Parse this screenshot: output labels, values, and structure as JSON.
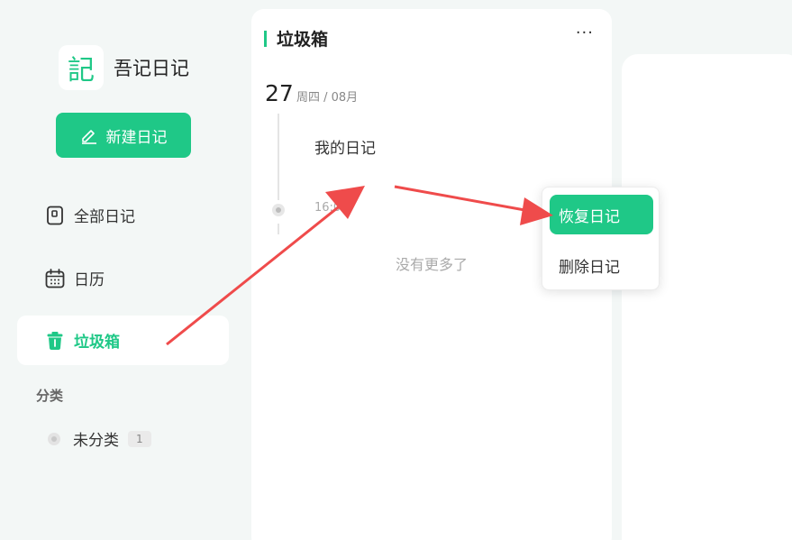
{
  "app": {
    "logo_char": "記",
    "name": "吾记日记"
  },
  "sidebar": {
    "new_button": "新建日记",
    "items": [
      {
        "label": "全部日记",
        "icon": "notebook-icon"
      },
      {
        "label": "日历",
        "icon": "calendar-icon"
      },
      {
        "label": "垃圾箱",
        "icon": "trash-icon"
      }
    ],
    "section_title": "分类",
    "categories": [
      {
        "label": "未分类",
        "count": "1"
      }
    ]
  },
  "list": {
    "title": "垃圾箱",
    "more": "···",
    "date_day": "27",
    "date_meta": "周四 / 08月",
    "entry_title": "我的日记",
    "entry_time": "16:0",
    "no_more": "没有更多了"
  },
  "context_menu": {
    "restore": "恢复日记",
    "delete": "删除日记"
  },
  "colors": {
    "accent": "#1fc887",
    "arrow": "#ef4b4b"
  }
}
